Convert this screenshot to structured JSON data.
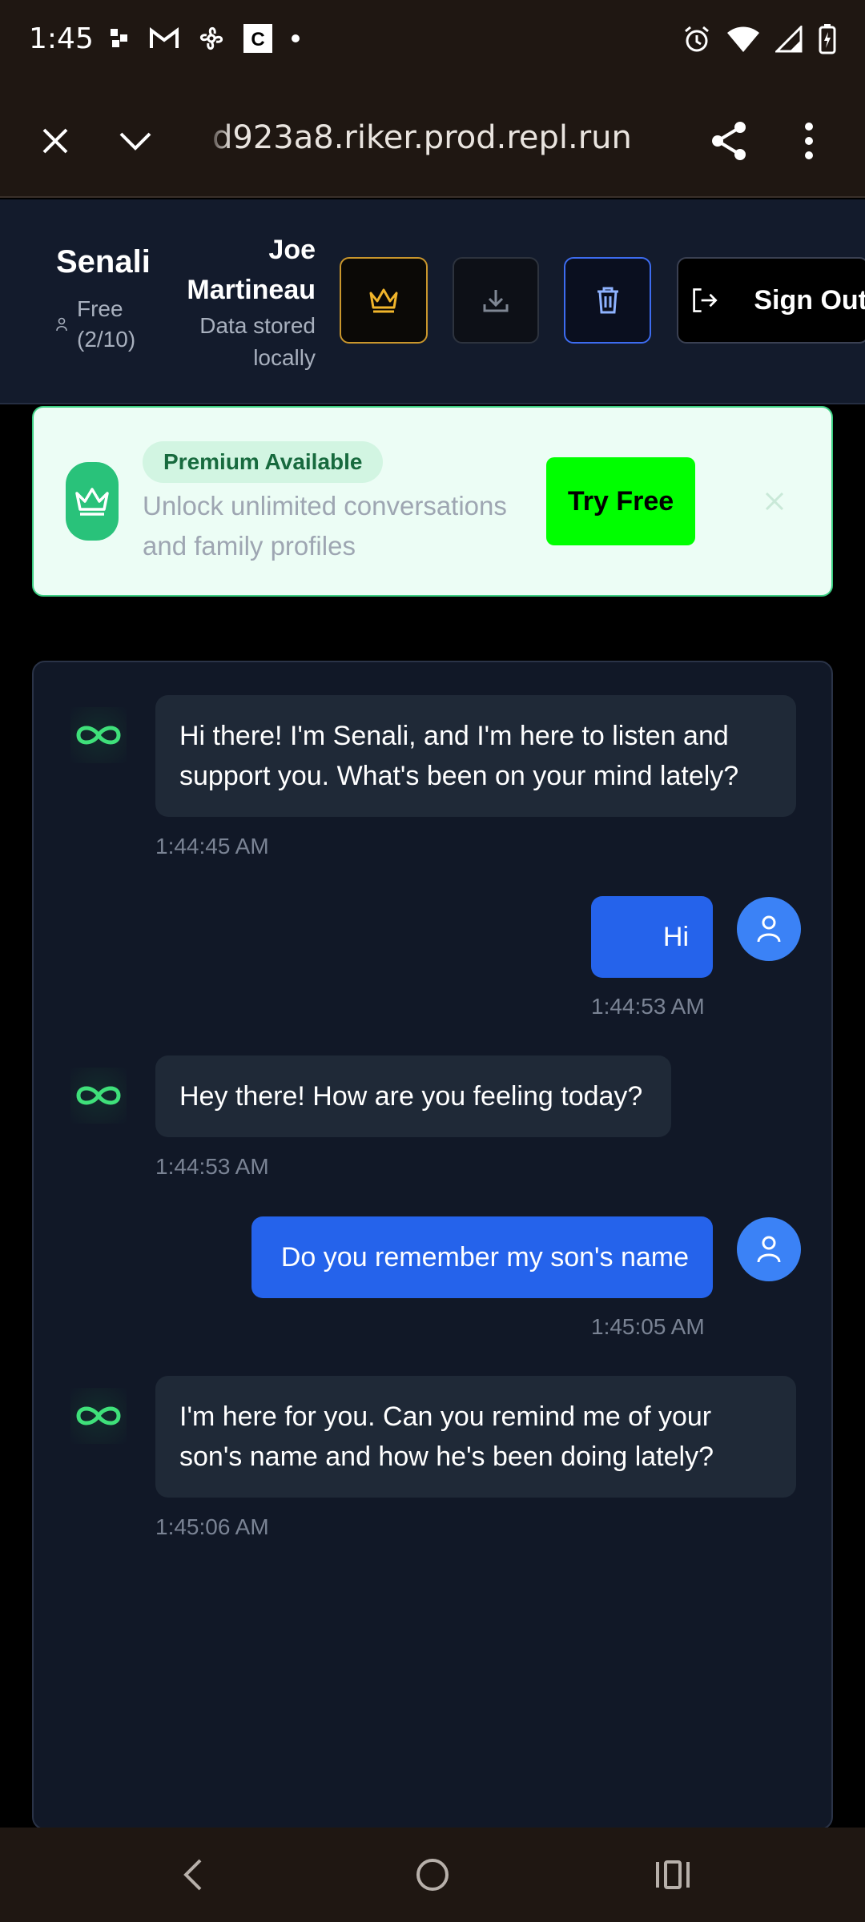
{
  "status_bar": {
    "time": "1:45",
    "left_icons": [
      "grid-dots-icon",
      "gmail-icon",
      "pinwheel-icon",
      "c-app-icon",
      "dot-icon"
    ],
    "right_icons": [
      "alarm-icon",
      "wifi-icon",
      "signal-icon",
      "battery-charging-icon"
    ]
  },
  "browser": {
    "url": "d923a8.riker.prod.repl.run",
    "buttons": [
      "close-icon",
      "chevron-down-icon",
      "share-icon",
      "more-vert-icon"
    ]
  },
  "header": {
    "app_name": "Senali",
    "plan": "Free\n(2/10)",
    "user_name": "Joe\nMartineau",
    "storage_note": "Data stored\nlocally",
    "sign_out_label": "Sign Out"
  },
  "banner": {
    "badge": "Premium Available",
    "description": "Unlock unlimited conversations and family profiles",
    "cta": "Try Free"
  },
  "colors": {
    "accent_green": "#00ff00",
    "user_bubble": "#2563eb",
    "bot_bubble": "#1f2937",
    "panel_bg": "#111827"
  },
  "messages": [
    {
      "sender": "bot",
      "text": "Hi there! I'm Senali, and I'm here to listen and support you. What's been on your mind lately?",
      "time": "1:44:45 AM"
    },
    {
      "sender": "user",
      "text": "Hi",
      "time": "1:44:53 AM"
    },
    {
      "sender": "bot",
      "text": "Hey there! How are you feeling today?",
      "time": "1:44:53 AM"
    },
    {
      "sender": "user",
      "text": "Do you remember my son's name",
      "time": "1:45:05 AM"
    },
    {
      "sender": "bot",
      "text": "I'm here for you. Can you remind me of your son's name and how he's been doing lately?",
      "time": "1:45:06 AM"
    }
  ],
  "nav": [
    "back-icon",
    "home-icon",
    "recents-icon"
  ]
}
